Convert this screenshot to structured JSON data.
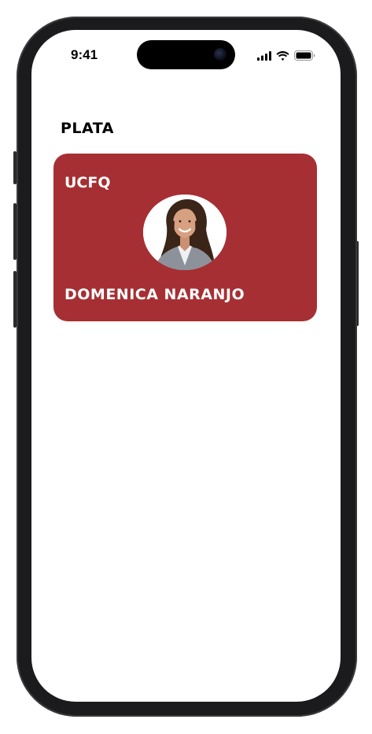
{
  "status_bar": {
    "time": "9:41",
    "icons": [
      "cellular-signal-icon",
      "wifi-icon",
      "battery-icon"
    ]
  },
  "page": {
    "section_title": "PLATA"
  },
  "card": {
    "organization": "UCFQ",
    "holder_name": "DOMENICA NARANJO",
    "background_color": "#a62f33",
    "photo": "profile-photo"
  }
}
